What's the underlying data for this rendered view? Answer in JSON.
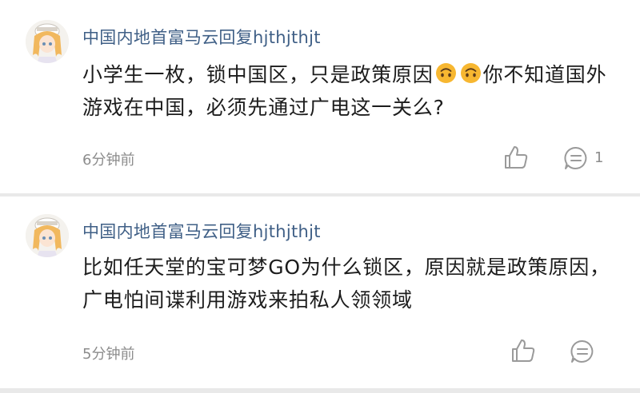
{
  "comments": [
    {
      "username": "中国内地首富马云回复hjthjthjt",
      "text_before_emoji": "小学生一枚，锁中国区，只是政策原因",
      "emoji_icon": "upside-down-face-emoji",
      "text_after_emoji": "你不知道国外游戏在中国，必须先通过广电这一关么?",
      "time": "6分钟前",
      "reply_count": "1"
    },
    {
      "username": "中国内地首富马云回复hjthjthjt",
      "text": "比如任天堂的宝可梦GO为什么锁区，原因就是政策原因，广电怕间谍利用游戏来拍私人领领域",
      "time": "5分钟前",
      "reply_count": ""
    }
  ],
  "colors": {
    "username": "#3f5f86",
    "content": "#1c1c1c",
    "meta": "#8c8c8c",
    "separator": "#e9e9e9",
    "emoji": "#f7b731"
  }
}
